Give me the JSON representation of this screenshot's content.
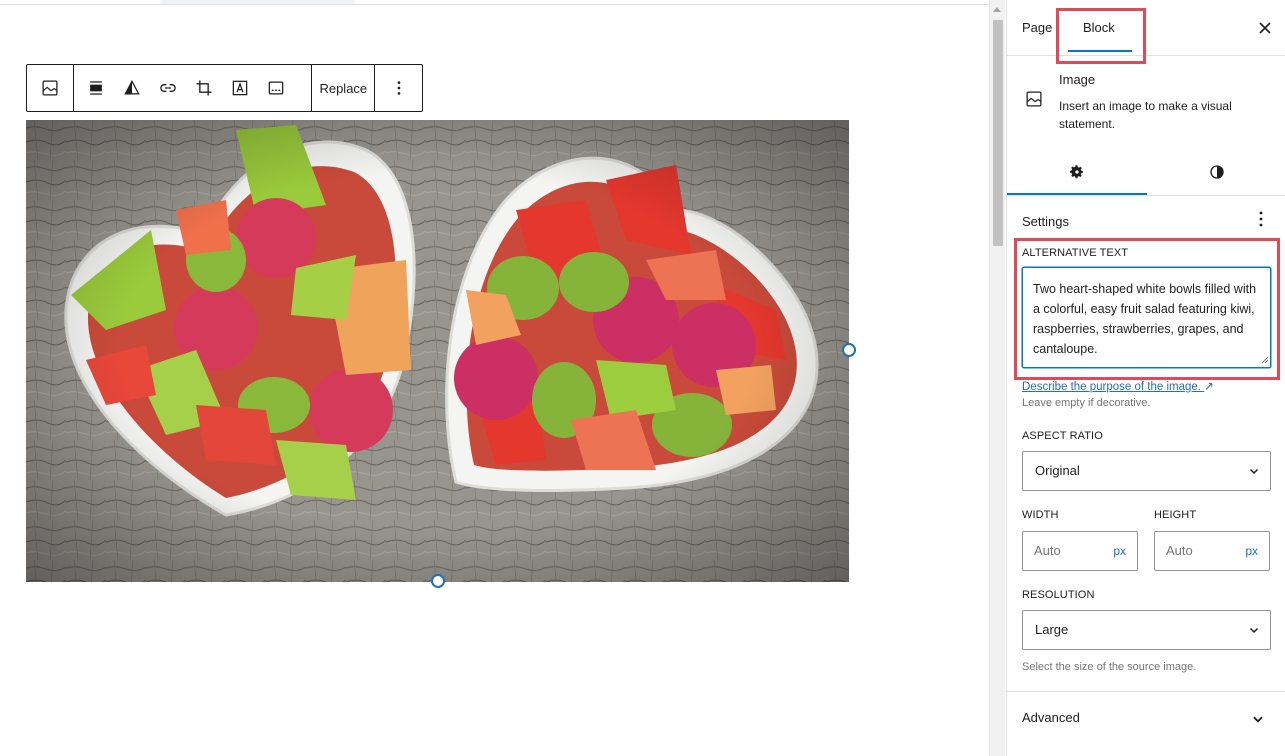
{
  "toolbar": {
    "replace_label": "Replace"
  },
  "sidebar": {
    "tabs": [
      {
        "label": "Page"
      },
      {
        "label": "Block"
      }
    ],
    "block": {
      "title": "Image",
      "description": "Insert an image to make a visual statement."
    },
    "settings_title": "Settings",
    "alt_text": {
      "label": "ALTERNATIVE TEXT",
      "value": "Two heart-shaped white bowls filled with a colorful, easy fruit salad featuring kiwi, raspberries, strawberries, grapes, and cantaloupe.",
      "help_link": "Describe the purpose of the image.",
      "help_link_icon": "↗",
      "help_text": "Leave empty if decorative."
    },
    "aspect_ratio": {
      "label": "ASPECT RATIO",
      "value": "Original"
    },
    "width": {
      "label": "WIDTH",
      "placeholder": "Auto",
      "unit": "px"
    },
    "height": {
      "label": "HEIGHT",
      "placeholder": "Auto",
      "unit": "px"
    },
    "resolution": {
      "label": "RESOLUTION",
      "value": "Large",
      "help": "Select the size of the source image."
    },
    "advanced_label": "Advanced"
  },
  "colors": {
    "accent": "#007cba",
    "highlight": "#e04a57",
    "link": "#2271b1"
  }
}
